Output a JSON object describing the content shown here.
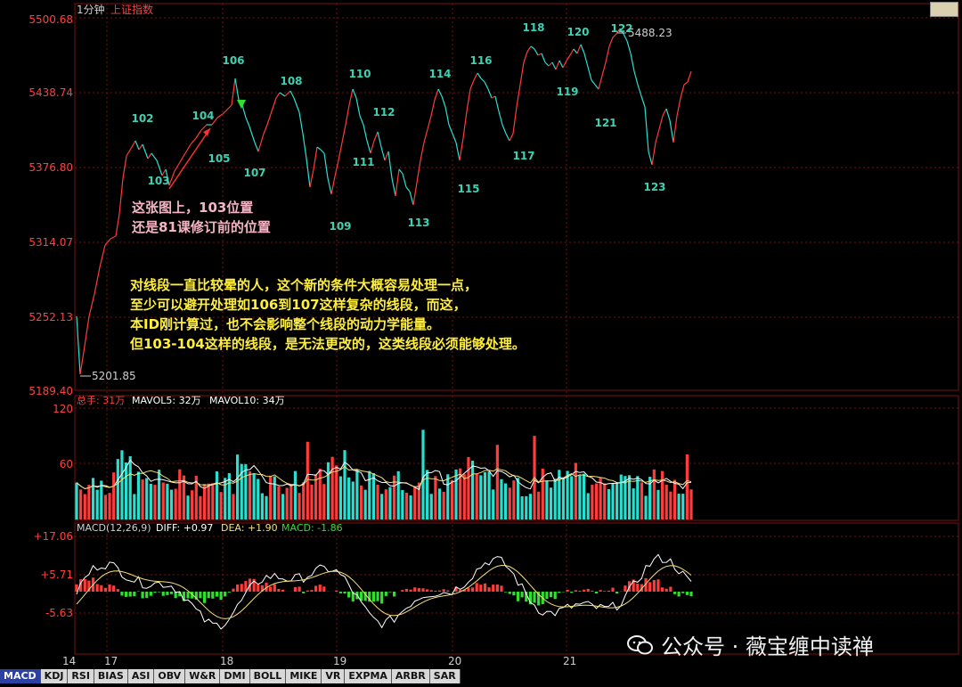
{
  "toolbar": {
    "period": "1分钟",
    "symbol": "上证指数"
  },
  "colors": {
    "up": "#ff3b3b",
    "down": "#29e0d0",
    "ma5": "#ffffff",
    "ma10": "#f4e07a",
    "diff": "#ffffff",
    "dea": "#f4e07a",
    "macd_neg": "#2fe02f",
    "grid": "#7a1010",
    "label": "#3dd1b3"
  },
  "price_axis": {
    "ticks": [
      "5500.68",
      "5438.74",
      "5376.80",
      "5314.07",
      "5252.13",
      "5189.40"
    ]
  },
  "price_marks": {
    "high": "5488.23",
    "low": "5201.85"
  },
  "segments": [
    {
      "n": "102",
      "x": 160,
      "y": 137
    },
    {
      "n": "103",
      "x": 178,
      "y": 207
    },
    {
      "n": "104",
      "x": 228,
      "y": 134
    },
    {
      "n": "105",
      "x": 246,
      "y": 182
    },
    {
      "n": "106",
      "x": 262,
      "y": 72
    },
    {
      "n": "107",
      "x": 286,
      "y": 198
    },
    {
      "n": "108",
      "x": 327,
      "y": 95
    },
    {
      "n": "109",
      "x": 382,
      "y": 258
    },
    {
      "n": "110",
      "x": 404,
      "y": 87
    },
    {
      "n": "111",
      "x": 408,
      "y": 186
    },
    {
      "n": "112",
      "x": 431,
      "y": 130
    },
    {
      "n": "113",
      "x": 470,
      "y": 254
    },
    {
      "n": "114",
      "x": 494,
      "y": 87
    },
    {
      "n": "115",
      "x": 526,
      "y": 216
    },
    {
      "n": "116",
      "x": 540,
      "y": 72
    },
    {
      "n": "117",
      "x": 588,
      "y": 179
    },
    {
      "n": "118",
      "x": 599,
      "y": 35
    },
    {
      "n": "119",
      "x": 637,
      "y": 107
    },
    {
      "n": "120",
      "x": 649,
      "y": 40
    },
    {
      "n": "121",
      "x": 680,
      "y": 142
    },
    {
      "n": "122",
      "x": 698,
      "y": 36
    },
    {
      "n": "123",
      "x": 735,
      "y": 214
    }
  ],
  "annotations": {
    "pink": [
      "这张图上，103位置",
      "还是81课修订前的位置"
    ],
    "yellow": [
      "对线段一直比较晕的人，这个新的条件大概容易处理一点，",
      "至少可以避开处理如106到107这样复杂的线段，而这，",
      "本ID刚计算过，也不会影响整个线段的动力学能量。",
      "但103-104这样的线段，是无法更改的，这类线段必须能够处理。"
    ]
  },
  "volume_panel": {
    "header": "总手: 31万",
    "mavol5": "MAVOL5: 32万",
    "mavol10": "MAVOL10: 34万",
    "ticks": [
      "120",
      "60"
    ]
  },
  "macd_panel": {
    "header": "MACD(12,26,9)",
    "diff": "DIFF: +0.97",
    "dea": "DEA: +1.90",
    "macd": "MACD: -1.86",
    "ticks": [
      "+17.06",
      "+5.71",
      "-5.63"
    ]
  },
  "date_axis": [
    "14",
    "17",
    "18",
    "19",
    "20",
    "21"
  ],
  "tabs": [
    "MACD",
    "KDJ",
    "RSI",
    "BIAS",
    "ASI",
    "OBV",
    "W&R",
    "DMI",
    "BOLL",
    "MIKE",
    "VR",
    "EXPMA",
    "ARBR",
    "SAR"
  ],
  "watermark": "公众号 · 薇宝缠中读禅",
  "chart_data": [
    {
      "type": "line",
      "title": "上证指数 1分钟",
      "ylim": [
        5189.4,
        5500.68
      ],
      "price_path": [
        [
          86,
          355
        ],
        [
          90,
          420
        ],
        [
          94,
          395
        ],
        [
          100,
          355
        ],
        [
          106,
          330
        ],
        [
          112,
          300
        ],
        [
          118,
          275
        ],
        [
          124,
          268
        ],
        [
          130,
          265
        ],
        [
          134,
          240
        ],
        [
          138,
          200
        ],
        [
          142,
          175
        ],
        [
          148,
          165
        ],
        [
          152,
          158
        ],
        [
          156,
          168
        ],
        [
          160,
          162
        ],
        [
          166,
          178
        ],
        [
          170,
          172
        ],
        [
          176,
          180
        ],
        [
          182,
          197
        ],
        [
          186,
          190
        ],
        [
          190,
          208
        ],
        [
          196,
          192
        ],
        [
          202,
          182
        ],
        [
          208,
          172
        ],
        [
          214,
          162
        ],
        [
          220,
          155
        ],
        [
          226,
          146
        ],
        [
          232,
          140
        ],
        [
          238,
          140
        ],
        [
          244,
          132
        ],
        [
          250,
          128
        ],
        [
          256,
          122
        ],
        [
          260,
          118
        ],
        [
          264,
          88
        ],
        [
          268,
          112
        ],
        [
          272,
          118
        ],
        [
          276,
          132
        ],
        [
          280,
          142
        ],
        [
          286,
          160
        ],
        [
          290,
          170
        ],
        [
          296,
          150
        ],
        [
          300,
          140
        ],
        [
          304,
          128
        ],
        [
          310,
          110
        ],
        [
          314,
          104
        ],
        [
          320,
          108
        ],
        [
          326,
          102
        ],
        [
          330,
          110
        ],
        [
          336,
          126
        ],
        [
          340,
          150
        ],
        [
          344,
          178
        ],
        [
          348,
          210
        ],
        [
          352,
          190
        ],
        [
          356,
          165
        ],
        [
          360,
          168
        ],
        [
          364,
          172
        ],
        [
          368,
          200
        ],
        [
          372,
          218
        ],
        [
          376,
          198
        ],
        [
          380,
          180
        ],
        [
          384,
          160
        ],
        [
          388,
          140
        ],
        [
          392,
          118
        ],
        [
          396,
          100
        ],
        [
          400,
          110
        ],
        [
          404,
          130
        ],
        [
          408,
          140
        ],
        [
          412,
          158
        ],
        [
          416,
          172
        ],
        [
          420,
          158
        ],
        [
          424,
          148
        ],
        [
          428,
          165
        ],
        [
          432,
          180
        ],
        [
          436,
          170
        ],
        [
          440,
          200
        ],
        [
          444,
          220
        ],
        [
          448,
          190
        ],
        [
          452,
          195
        ],
        [
          456,
          210
        ],
        [
          460,
          215
        ],
        [
          464,
          230
        ],
        [
          468,
          205
        ],
        [
          472,
          180
        ],
        [
          476,
          160
        ],
        [
          480,
          145
        ],
        [
          484,
          130
        ],
        [
          488,
          112
        ],
        [
          492,
          100
        ],
        [
          496,
          108
        ],
        [
          500,
          120
        ],
        [
          504,
          140
        ],
        [
          508,
          150
        ],
        [
          512,
          160
        ],
        [
          516,
          180
        ],
        [
          520,
          155
        ],
        [
          524,
          125
        ],
        [
          528,
          100
        ],
        [
          532,
          90
        ],
        [
          536,
          82
        ],
        [
          540,
          88
        ],
        [
          544,
          92
        ],
        [
          548,
          100
        ],
        [
          552,
          110
        ],
        [
          556,
          108
        ],
        [
          560,
          125
        ],
        [
          564,
          140
        ],
        [
          568,
          150
        ],
        [
          572,
          158
        ],
        [
          576,
          150
        ],
        [
          580,
          120
        ],
        [
          584,
          95
        ],
        [
          588,
          70
        ],
        [
          592,
          58
        ],
        [
          596,
          52
        ],
        [
          600,
          55
        ],
        [
          604,
          62
        ],
        [
          608,
          60
        ],
        [
          612,
          70
        ],
        [
          616,
          74
        ],
        [
          620,
          70
        ],
        [
          624,
          78
        ],
        [
          628,
          68
        ],
        [
          632,
          76
        ],
        [
          636,
          68
        ],
        [
          640,
          62
        ],
        [
          644,
          55
        ],
        [
          648,
          60
        ],
        [
          652,
          50
        ],
        [
          656,
          60
        ],
        [
          660,
          75
        ],
        [
          664,
          90
        ],
        [
          668,
          95
        ],
        [
          672,
          100
        ],
        [
          676,
          85
        ],
        [
          680,
          70
        ],
        [
          684,
          52
        ],
        [
          688,
          42
        ],
        [
          692,
          38
        ],
        [
          696,
          32
        ],
        [
          700,
          38
        ],
        [
          704,
          46
        ],
        [
          708,
          60
        ],
        [
          712,
          80
        ],
        [
          716,
          95
        ],
        [
          720,
          108
        ],
        [
          724,
          120
        ],
        [
          728,
          170
        ],
        [
          732,
          185
        ],
        [
          736,
          160
        ],
        [
          740,
          145
        ],
        [
          744,
          130
        ],
        [
          748,
          122
        ],
        [
          752,
          135
        ],
        [
          756,
          160
        ],
        [
          760,
          130
        ],
        [
          764,
          110
        ],
        [
          768,
          95
        ],
        [
          772,
          92
        ],
        [
          776,
          80
        ]
      ],
      "high": 5488.23,
      "low": 5201.85
    },
    {
      "type": "bar",
      "title": "总手",
      "ylim": [
        0,
        120
      ],
      "ticks": [
        120,
        60
      ],
      "n_bars": 150,
      "x_range": [
        86,
        776
      ]
    },
    {
      "type": "bar",
      "title": "MACD(12,26,9)",
      "ylim": [
        -5.63,
        17.06
      ],
      "ticks": [
        17.06,
        5.71,
        -5.63
      ],
      "diff": 0.97,
      "dea": 1.9,
      "macd": -1.86,
      "x_range": [
        86,
        776
      ]
    }
  ]
}
